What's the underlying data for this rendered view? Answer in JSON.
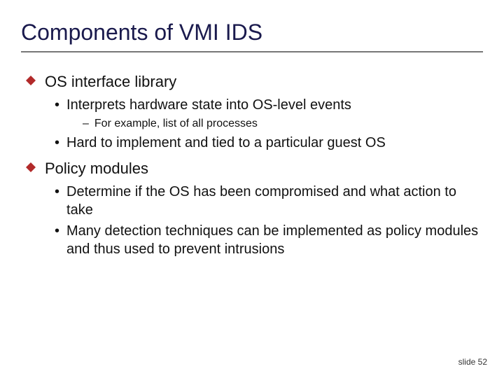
{
  "title": "Components of VMI IDS",
  "sections": [
    {
      "heading": "OS interface library",
      "items": [
        {
          "text": "Interprets hardware state into OS-level events",
          "sub": [
            "For example, list of all processes"
          ]
        },
        {
          "text": "Hard to implement and tied to a particular guest OS",
          "sub": []
        }
      ]
    },
    {
      "heading": "Policy modules",
      "items": [
        {
          "text": "Determine if the OS has been compromised and what action to take",
          "sub": []
        },
        {
          "text": "Many detection techniques can be implemented as policy modules and thus used to prevent intrusions",
          "sub": []
        }
      ]
    }
  ],
  "footer": "slide 52",
  "bullets": {
    "l2": "•",
    "l3": "–"
  },
  "colors": {
    "diamond": "#b22a2a",
    "title": "#1a1a4d"
  }
}
